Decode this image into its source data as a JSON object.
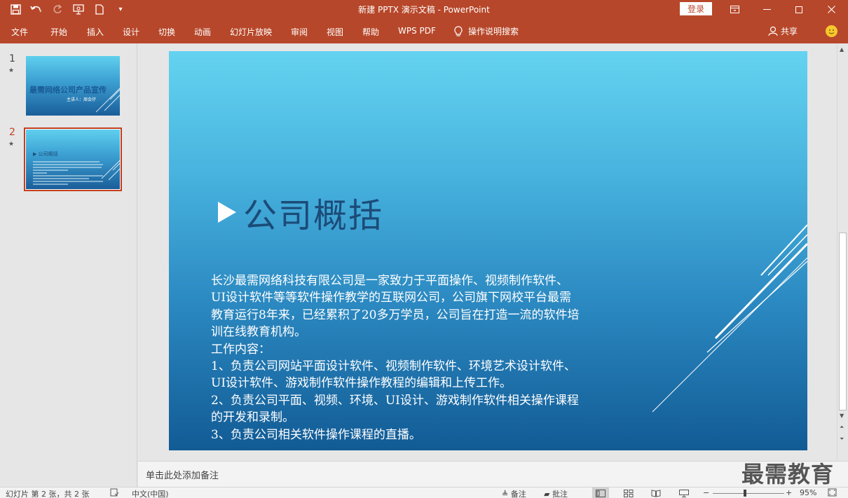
{
  "window": {
    "title": "新建 PPTX 演示文稿 - PowerPoint",
    "login_label": "登录",
    "accent_color": "#b7472a"
  },
  "quick_access": [
    "save-icon",
    "undo-icon",
    "redo-icon",
    "start-from-beginning-icon",
    "new-file-icon",
    "customize-icon"
  ],
  "ribbon": {
    "tabs": [
      "文件",
      "开始",
      "插入",
      "设计",
      "切换",
      "动画",
      "幻灯片放映",
      "审阅",
      "视图",
      "帮助",
      "WPS PDF"
    ],
    "tell_me": "操作说明搜索",
    "share": "共享"
  },
  "thumbnails": [
    {
      "number": "1",
      "title": "最需网络公司产品宣传",
      "subtitle": "主讲人：周会仔"
    },
    {
      "number": "2",
      "title": "公司概括"
    }
  ],
  "slide": {
    "title": "公司概括",
    "body_lines": [
      "长沙最需网络科技有限公司是一家致力于平面操作、视频制作软件、",
      "UI设计软件等等软件操作教学的互联网公司，公司旗下网校平台最需",
      "教育运行8年来，已经累积了20多万学员，公司旨在打造一流的软件培",
      "训在线教育机构。",
      "工作内容：",
      "1、负责公司网站平面设计软件、视频制作软件、环境艺术设计软件、",
      "UI设计软件、游戏制作软件操作教程的编辑和上传工作。",
      "2、负责公司平面、视频、环境、UI设计、游戏制作软件相关操作课程",
      "的开发和录制。",
      "3、负责公司相关软件操作课程的直播。"
    ]
  },
  "notes": {
    "placeholder": "单击此处添加备注"
  },
  "watermark": "最需教育",
  "status": {
    "slide_info": "幻灯片 第 2 张，共 2 张",
    "language": "中文(中国)",
    "notes_label": "备注",
    "comments_label": "批注",
    "zoom": "95%"
  }
}
